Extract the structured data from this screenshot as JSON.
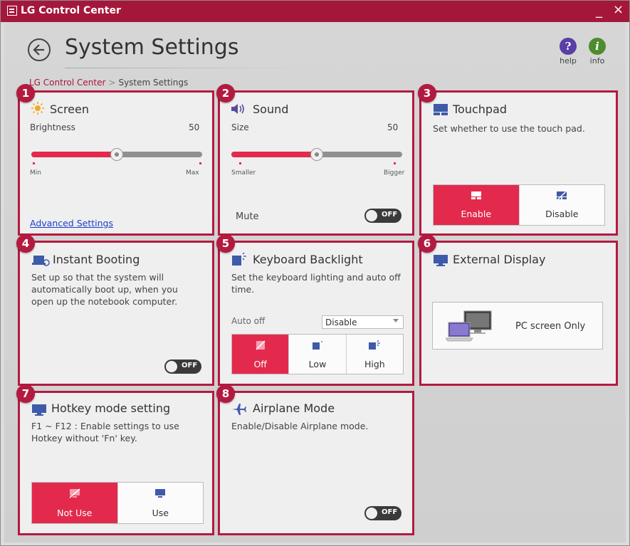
{
  "window": {
    "title": "LG Control Center",
    "minimize_glyph": "_",
    "close_glyph": "×"
  },
  "header": {
    "title": "System Settings",
    "help_label": "help",
    "info_label": "info",
    "help_glyph": "?",
    "info_glyph": "i"
  },
  "breadcrumb": {
    "parent": "LG Control Center",
    "separator": ">",
    "current": "System Settings"
  },
  "screen": {
    "badge": "1",
    "title": "Screen",
    "brightness_label": "Brightness",
    "brightness_value": "50",
    "brightness_level": 50,
    "min_label": "Min",
    "max_label": "Max",
    "advanced_link": "Advanced Settings"
  },
  "sound": {
    "badge": "2",
    "title": "Sound",
    "size_label": "Size",
    "size_value": "50",
    "size_level": 50,
    "smaller_label": "Smaller",
    "bigger_label": "Bigger",
    "mute_label": "Mute",
    "mute_state": "OFF"
  },
  "touchpad": {
    "badge": "3",
    "title": "Touchpad",
    "desc": "Set whether to use the touch pad.",
    "enable_label": "Enable",
    "disable_label": "Disable"
  },
  "instant_booting": {
    "badge": "4",
    "title": "Instant Booting",
    "desc": "Set up so that the system will automatically boot up, when you open up the notebook computer.",
    "toggle_state": "OFF"
  },
  "keyboard_backlight": {
    "badge": "5",
    "title": "Keyboard Backlight",
    "desc": "Set the keyboard lighting and auto off time.",
    "auto_off_label": "Auto off",
    "auto_off_value": "Disable",
    "off_label": "Off",
    "low_label": "Low",
    "high_label": "High"
  },
  "external_display": {
    "badge": "6",
    "title": "External Display",
    "button_label": "PC screen Only"
  },
  "hotkey": {
    "badge": "7",
    "title": "Hotkey mode setting",
    "desc": "F1 ~ F12 : Enable settings to use Hotkey without 'Fn' key.",
    "not_use_label": "Not Use",
    "use_label": "Use"
  },
  "airplane": {
    "badge": "8",
    "title": "Airplane Mode",
    "desc": "Enable/Disable Airplane mode.",
    "toggle_state": "OFF"
  },
  "colors": {
    "accent": "#e32a4d",
    "title_bar": "#a5173a",
    "highlight_border": "#b31a40"
  }
}
